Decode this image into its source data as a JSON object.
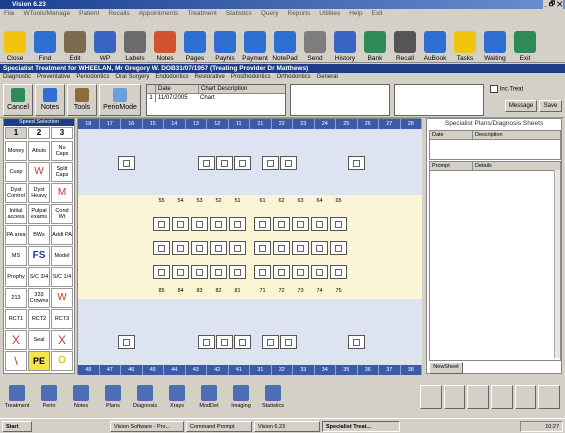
{
  "window": {
    "title": "Vision 6.23",
    "controls": "_ 🗗 ✕"
  },
  "menu": [
    "File",
    "WTools/Manage",
    "Patient",
    "Recalls",
    "Appointments",
    "Treatment",
    "Statistics",
    "Query",
    "Reports",
    "Utilities",
    "Help",
    "Exit"
  ],
  "toolbar": [
    {
      "label": "Close",
      "color": "#f1c40f"
    },
    {
      "label": "Find",
      "color": "#2e6fd1"
    },
    {
      "label": "Edit",
      "color": "#7d6a4f"
    },
    {
      "label": "WP",
      "color": "#3b63c4"
    },
    {
      "label": "Labels",
      "color": "#6b6b6b"
    },
    {
      "label": "Notes",
      "color": "#d1522e"
    },
    {
      "label": "Pages",
      "color": "#2e6fd1"
    },
    {
      "label": "Payhis",
      "color": "#2e6fd1"
    },
    {
      "label": "Payment",
      "color": "#2e6fd1"
    },
    {
      "label": "NotePad",
      "color": "#2e6fd1"
    },
    {
      "label": "Send",
      "color": "#7d7d7d"
    },
    {
      "label": "History",
      "color": "#3b63c4"
    },
    {
      "label": "Bank",
      "color": "#2e8b57"
    },
    {
      "label": "Recall",
      "color": "#555"
    },
    {
      "label": "AuBook",
      "color": "#2e6fd1"
    },
    {
      "label": "Tasks",
      "color": "#f1c40f"
    },
    {
      "label": "Waiting",
      "color": "#2e6fd1"
    },
    {
      "label": "Exit",
      "color": "#2e8b57"
    }
  ],
  "header": {
    "text": "Specialist Treatment for WHEELAN, Mr Gregory W. DOB31/07/1957 (Treating Provider Dr Matthews)"
  },
  "tabs": [
    "Diagnostic",
    "Preventative",
    "Periodontics",
    "Oral Surgery",
    "Endodontics",
    "Restorative",
    "Prosthodontics",
    "Orthodontics",
    "General"
  ],
  "subtool": {
    "buttons": [
      "Cancel",
      "Notes",
      "Tools",
      "PerioMode"
    ],
    "grid_headers": [
      "Date",
      "Chart Description"
    ],
    "row": {
      "num": "1",
      "date": "11/07/2005",
      "desc": "Chart"
    },
    "inc_treat": "Inc.Treat",
    "message": "Message",
    "save": "Save"
  },
  "left_panel": {
    "title": "Speed Selection",
    "tabs": [
      "1",
      "2",
      "3"
    ],
    "cells": [
      [
        "Money",
        "Abuts",
        "Nu Caps"
      ],
      [
        "Cusp",
        "W",
        "Split Caps"
      ],
      [
        "Dyst Control",
        "Dyst Heavy",
        "M"
      ],
      [
        "Initial access",
        "Pulpal exams",
        "Cond Wt"
      ],
      [
        "PA area",
        "BWs",
        "Addt PA"
      ],
      [
        "MS",
        "FS",
        "Model"
      ],
      [
        "Prophy",
        "S/C 3/4",
        "S/C 1/4"
      ],
      [
        "213",
        "333 Crowns",
        "W"
      ],
      [
        "RCT1",
        "RCT2",
        "RCT3"
      ],
      [
        "X",
        "Seal",
        "X"
      ],
      [
        "\\",
        "PE",
        "O"
      ]
    ]
  },
  "chart": {
    "top_numbers": [
      "18",
      "17",
      "16",
      "15",
      "14",
      "13",
      "12",
      "11",
      "21",
      "22",
      "23",
      "24",
      "25",
      "26",
      "27",
      "28"
    ],
    "primary_upper": [
      "55",
      "54",
      "53",
      "52",
      "51",
      "61",
      "62",
      "63",
      "64",
      "65"
    ],
    "primary_lower": [
      "85",
      "84",
      "83",
      "82",
      "81",
      "71",
      "72",
      "73",
      "74",
      "75"
    ],
    "bottom_numbers": [
      "48",
      "47",
      "46",
      "45",
      "44",
      "43",
      "42",
      "41",
      "31",
      "32",
      "33",
      "34",
      "35",
      "36",
      "37",
      "38"
    ]
  },
  "right_panel": {
    "title": "Specialist Plans/Diagnosis Sheets",
    "top_headers": [
      "Date",
      "Description"
    ],
    "bottom_headers": [
      "Prompt",
      "Details"
    ],
    "new_sheet": "NewSheet"
  },
  "bottom_toolbar": [
    "Treatment",
    "Perio",
    "Notes",
    "Plans",
    "Diagnosis",
    "Xrays",
    "ModDet",
    "Imaging",
    "Statistics"
  ],
  "taskbar": {
    "start": "Start",
    "items": [
      "Vision Software - Pro...",
      "Command Prompt",
      "Vision 6.23",
      "Specialist Treat..."
    ],
    "clock": "10:27"
  }
}
